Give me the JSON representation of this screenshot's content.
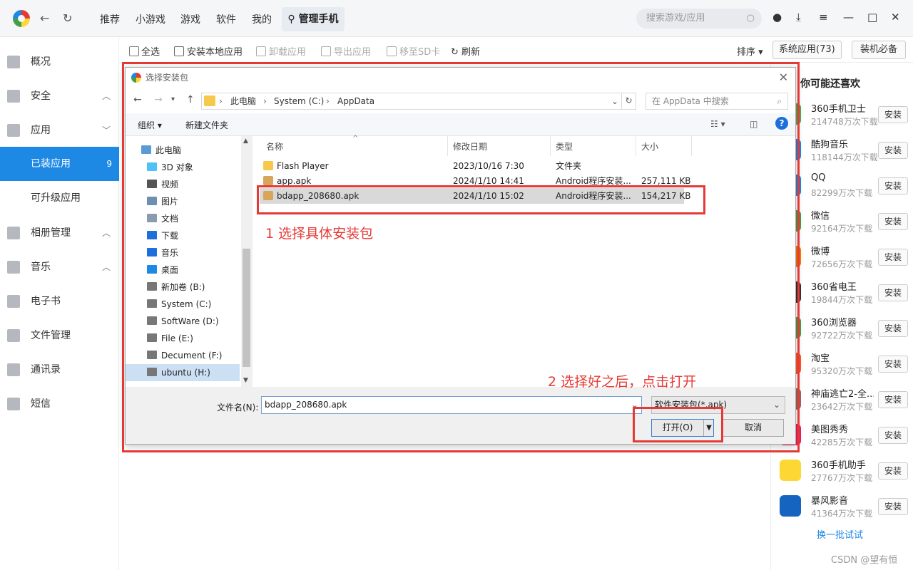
{
  "app": {
    "tabs": [
      "推荐",
      "小游戏",
      "游戏",
      "软件",
      "我的"
    ],
    "active_tab": "管理手机",
    "search_placeholder": "搜索游戏/应用"
  },
  "sidebar": {
    "items": [
      {
        "label": "概况",
        "chevron": ""
      },
      {
        "label": "安全",
        "chevron": "^"
      },
      {
        "label": "应用",
        "chevron": "v"
      },
      {
        "label": "已装应用",
        "count": "9"
      },
      {
        "label": "可升级应用"
      },
      {
        "label": "相册管理",
        "chevron": "^"
      },
      {
        "label": "音乐",
        "chevron": "^"
      },
      {
        "label": "电子书"
      },
      {
        "label": "文件管理"
      },
      {
        "label": "通讯录"
      },
      {
        "label": "短信"
      }
    ]
  },
  "toolbar": {
    "select_all": "全选",
    "install_local": "安装本地应用",
    "uninstall": "卸载应用",
    "export": "导出应用",
    "move_sd": "移至SD卡",
    "refresh": "刷新",
    "sort": "排序",
    "system_apps": "系统应用(73)",
    "essentials": "装机必备"
  },
  "recommend": {
    "title": "你可能还喜欢",
    "install_label": "安装",
    "more": "换一批试试",
    "items": [
      {
        "name": "360手机卫士",
        "downloads": "214748万次下载",
        "color": "#4caf50"
      },
      {
        "name": "酷狗音乐",
        "downloads": "118144万次下载",
        "color": "#1e88e5"
      },
      {
        "name": "QQ",
        "downloads": "82299万次下载",
        "color": "#1e88e5"
      },
      {
        "name": "微信",
        "downloads": "92164万次下载",
        "color": "#43a047"
      },
      {
        "name": "微博",
        "downloads": "72656万次下载",
        "color": "#f57c00"
      },
      {
        "name": "360省电王",
        "downloads": "19844万次下载",
        "color": "#333333"
      },
      {
        "name": "360浏览器",
        "downloads": "92722万次下载",
        "color": "#43a047"
      },
      {
        "name": "淘宝",
        "downloads": "95320万次下载",
        "color": "#ff5722"
      },
      {
        "name": "神庙逃亡2-全...",
        "downloads": "23642万次下载",
        "color": "#8d6e63"
      },
      {
        "name": "美图秀秀",
        "downloads": "42285万次下载",
        "color": "#e91e63"
      },
      {
        "name": "360手机助手",
        "downloads": "27767万次下载",
        "color": "#fdd835"
      },
      {
        "name": "暴风影音",
        "downloads": "41364万次下载",
        "color": "#1565c0"
      }
    ]
  },
  "dialog": {
    "title": "选择安装包",
    "breadcrumb": [
      "此电脑",
      "System (C:)",
      "AppData"
    ],
    "search_placeholder": "在 AppData 中搜索",
    "organize": "组织 ▾",
    "new_folder": "新建文件夹",
    "nav": [
      "此电脑",
      "3D 对象",
      "视频",
      "图片",
      "文档",
      "下载",
      "音乐",
      "桌面",
      "新加卷 (B:)",
      "System (C:)",
      "SoftWare (D:)",
      "File (E:)",
      "Decument (F:)",
      "ubuntu (H:)"
    ],
    "columns": [
      "名称",
      "修改日期",
      "类型",
      "大小"
    ],
    "files": [
      {
        "name": "Flash Player",
        "date": "2023/10/16 7:30",
        "type": "文件夹",
        "size": ""
      },
      {
        "name": "app.apk",
        "date": "2024/1/10 14:41",
        "type": "Android程序安装...",
        "size": "257,111 KB"
      },
      {
        "name": "bdapp_208680.apk",
        "date": "2024/1/10 15:02",
        "type": "Android程序安装...",
        "size": "154,217 KB"
      }
    ],
    "filename_label": "文件名(N):",
    "filename_value": "bdapp_208680.apk",
    "filetype": "软件安装包(*.apk)",
    "open": "打开(O)",
    "cancel": "取消"
  },
  "annotations": {
    "step1": "1 选择具体安装包",
    "step2": "2 选择好之后，点击打开"
  },
  "watermark": "CSDN @望有恒"
}
